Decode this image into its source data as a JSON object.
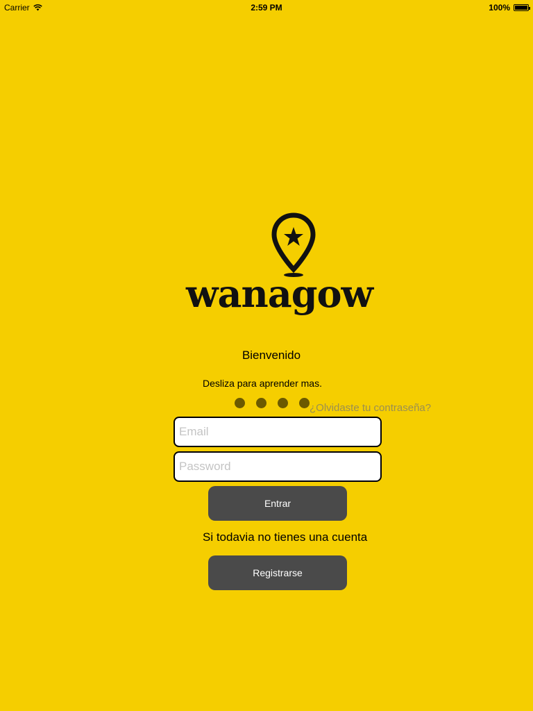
{
  "status_bar": {
    "carrier": "Carrier",
    "time": "2:59 PM",
    "battery": "100%"
  },
  "logo": {
    "text": "wanagow",
    "icon": "map-pin-star-icon"
  },
  "welcome": {
    "title": "Bienvenido",
    "subtitle": "Desliza para aprender mas."
  },
  "pager": {
    "page_count": 4
  },
  "login": {
    "forgot_password": "¿Olvidaste tu contraseña?",
    "email_placeholder": "Email",
    "password_placeholder": "Password",
    "submit_label": "Entrar"
  },
  "register": {
    "prompt": "Si todavia no tienes una cuenta",
    "button_label": "Registrarse"
  },
  "colors": {
    "background": "#F5CE00",
    "button": "#4A4A4A",
    "button_text": "#FFFFFF",
    "link": "#9A8F52"
  }
}
